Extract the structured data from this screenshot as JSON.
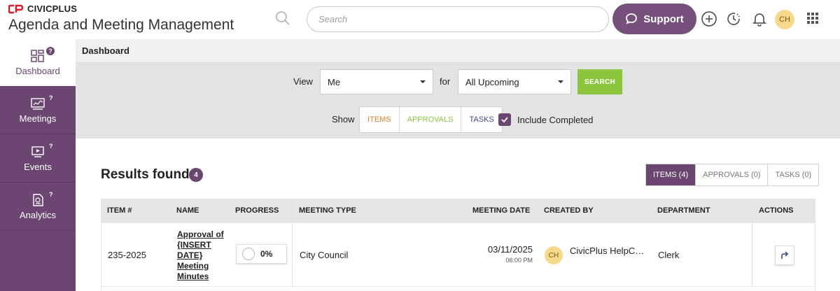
{
  "header": {
    "brand_name": "CIVICPLUS",
    "app_title": "Agenda and Meeting Management",
    "search_placeholder": "Search",
    "support_label": "Support",
    "user_initials": "CH"
  },
  "sidebar": {
    "items": [
      {
        "label": "Dashboard",
        "icon": "dashboard-icon",
        "active": true
      },
      {
        "label": "Meetings",
        "icon": "meetings-icon",
        "active": false
      },
      {
        "label": "Events",
        "icon": "events-icon",
        "active": false
      },
      {
        "label": "Analytics",
        "icon": "analytics-icon",
        "active": false
      }
    ],
    "help_mark": "?"
  },
  "breadcrumb": {
    "title": "Dashboard"
  },
  "filters": {
    "view_label": "View",
    "view_value": "Me",
    "for_label": "for",
    "for_value": "All Upcoming",
    "search_button": "SEARCH",
    "show_label": "Show",
    "show_options": [
      "ITEMS",
      "APPROVALS",
      "TASKS"
    ],
    "include_completed_label": "Include Completed",
    "include_completed_checked": true
  },
  "results": {
    "title": "Results found:",
    "count": "4",
    "tabs": [
      "ITEMS (4)",
      "APPROVALS (0)",
      "TASKS (0)"
    ],
    "active_tab": 0
  },
  "table": {
    "columns": [
      "ITEM #",
      "NAME",
      "PROGRESS",
      "MEETING TYPE",
      "MEETING DATE",
      "CREATED BY",
      "DEPARTMENT",
      "ACTIONS"
    ],
    "rows": [
      {
        "item_number": "235-2025",
        "name": "Approval of {INSERT DATE} Meeting Minutes",
        "progress": "0%",
        "meeting_type": "City Council",
        "meeting_date": "03/11/2025",
        "meeting_time": "06:00 PM",
        "created_by_initials": "CH",
        "created_by": "CivicPlus HelpCe...",
        "department": "Clerk"
      }
    ]
  },
  "colors": {
    "brand_purple": "#6a4670",
    "support_purple": "#75507b",
    "search_green": "#8cc63f",
    "items_orange": "#d9822b",
    "approvals_green": "#8cc63f",
    "tasks_navy": "#3b4a8a",
    "avatar_yellow": "#f6d98b",
    "brand_red": "#d6202b"
  }
}
